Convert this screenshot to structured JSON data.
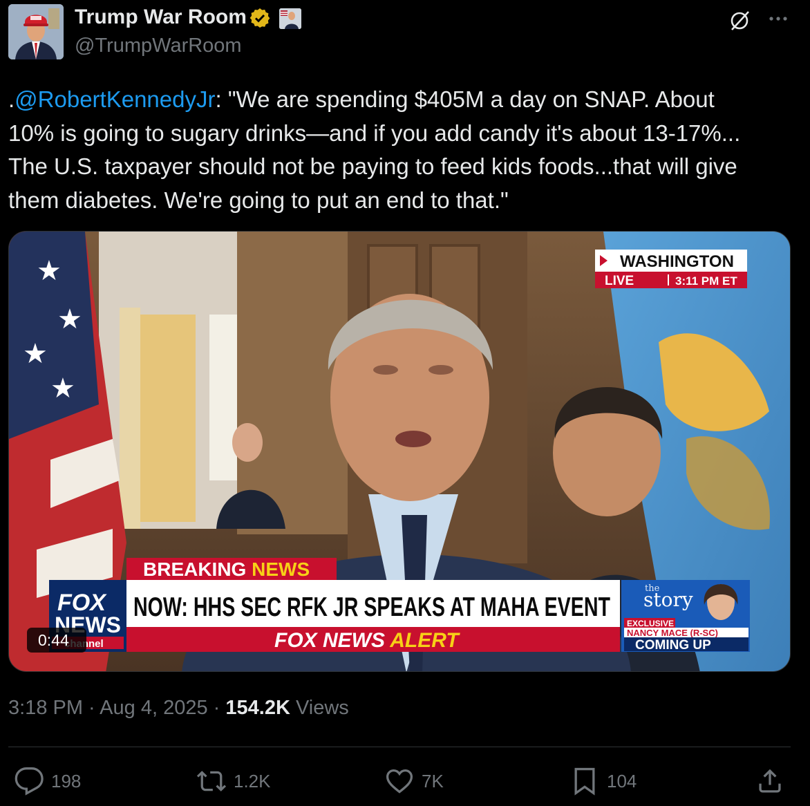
{
  "author": {
    "display_name": "Trump War Room",
    "handle": "@TrumpWarRoom",
    "verified_badge_icon": "gold-check-badge-icon",
    "affiliation_icon": "affiliate-avatar-icon"
  },
  "tweet": {
    "prefix": ".",
    "mention": "@RobertKennedyJr",
    "text": ": \"We are spending $405M a day on SNAP. About\n10% is going to sugary drinks—and if you add candy it's about 13-17%...\nThe U.S. taxpayer should not be paying to feed kids foods...that will give\nthem diabetes. We're going to put an end to that.\""
  },
  "video": {
    "duration": "0:44",
    "location": "WASHINGTON",
    "live_label": "LIVE",
    "live_time": "3:11 PM ET",
    "breaking_label_1": "BREAKING ",
    "breaking_label_2": "NEWS",
    "headline": "NOW: HHS SEC RFK JR SPEAKS AT MAHA EVENT",
    "alert_1": "FOX NEWS",
    "alert_2": " ALERT",
    "logo_line1": "FOX",
    "logo_line2": "NEWS",
    "logo_line3": "channel",
    "story_small": "the",
    "story_big": "story",
    "exclusive": "EXCLUSIVE",
    "guest": "NANCY MACE (R-SC)",
    "coming_up": "COMING UP"
  },
  "meta": {
    "time": "3:18 PM",
    "sep": " · ",
    "date": "Aug 4, 2025",
    "views_count": "154.2K",
    "views_label": " Views"
  },
  "actions": {
    "replies": "198",
    "reposts": "1.2K",
    "likes": "7K",
    "bookmarks": "104"
  }
}
